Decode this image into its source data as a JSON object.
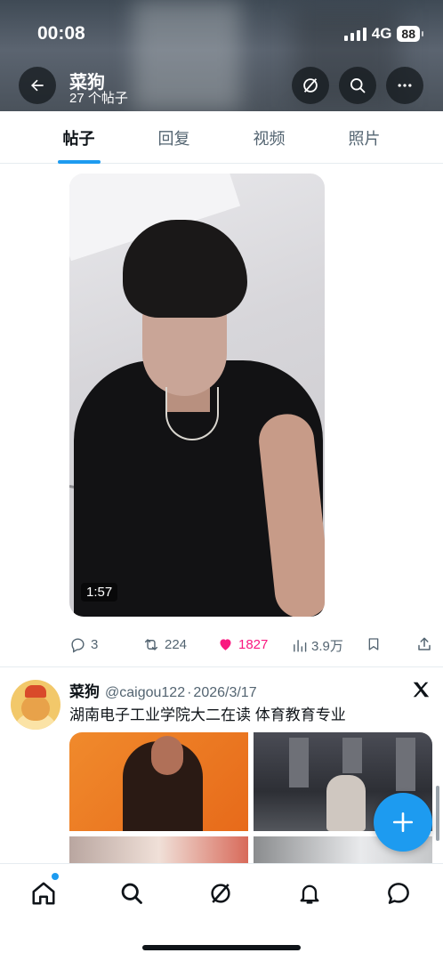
{
  "status_bar": {
    "time": "00:08",
    "network": "4G",
    "battery": "88"
  },
  "profile": {
    "name": "菜狗",
    "post_count": "27 个帖子"
  },
  "tabs": [
    {
      "label": "帖子",
      "active": true
    },
    {
      "label": "回复",
      "active": false
    },
    {
      "label": "视频",
      "active": false
    },
    {
      "label": "照片",
      "active": false
    }
  ],
  "video_post": {
    "duration": "1:57",
    "replies": "3",
    "reposts": "224",
    "likes": "1827",
    "views": "3.9万"
  },
  "second_post": {
    "name": "菜狗",
    "handle": "@caigou122",
    "separator": "·",
    "date": "2026/3/17",
    "text": "湖南电子工业学院大二在读 体育教育专业"
  },
  "colors": {
    "accent": "#1d9bf0",
    "like": "#f91880",
    "muted": "#536471"
  },
  "icons": {
    "back": "arrow-left-icon",
    "grok": "grok-icon",
    "search": "search-icon",
    "more": "more-icon",
    "compose": "plus-icon"
  },
  "bottom_nav": [
    "home-icon",
    "search-icon",
    "grok-icon",
    "notifications-icon",
    "messages-icon"
  ]
}
